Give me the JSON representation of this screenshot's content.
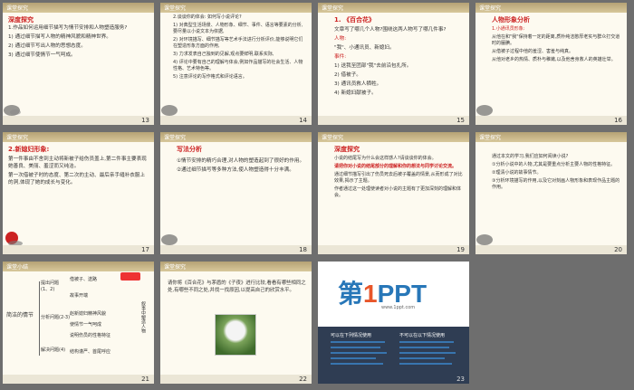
{
  "slides": [
    {
      "num": "13",
      "header": "课堂探究",
      "section": "深度探究",
      "question": "1.作品如何运用细节描写为情节安排和人物塑造服务?",
      "items": [
        "1) 通过细节描写人物的精神风貌和精神世界。",
        "2) 通过细节写出人物的思想态度。",
        "3) 通过细节使情节一气呵成。"
      ]
    },
    {
      "num": "14",
      "header": "课堂探究",
      "items": [
        "2.谈谈你的体会: 如何写小说评论?",
        "1) 对典型生活场景、人物形象、细节、事件、语言等要素的分析,要尽量以小说文本为依据,",
        "2) 对环境描写、细节描写等艺术手法进行分析评价,能够说明它们在塑造形象方面的作用,",
        "3) 力求发表自己独到的见解,观点要鲜明,联系实际,",
        "4) 评论中要有自己的理解与体会,例如作品描写的社会生活、人物性格、艺术特色等。",
        "5) 注意评论的写作格式和评论语言。"
      ]
    },
    {
      "num": "15",
      "header": "课堂探究",
      "section": "1. 《百合花》",
      "items": [
        "文章写了哪几个人物?围绕这两人物写了哪几件事?",
        "人物:",
        "\"我\"、小通讯员、新媳妇。",
        "事件:",
        "1) 送我至团部\"我\"去前沿包扎所。",
        "2) 借被子。",
        "3) 通讯员救人牺牲。",
        "4) 新媳妇献被子。"
      ]
    },
    {
      "num": "16",
      "header": "课堂探究",
      "section": "人物形象分析",
      "items": [
        "1.小通讯员形象:",
        "从他在和\"我\"保持着一定的距离,质朴纯洁憨厚老实与群众打交道时的腼腆。",
        "从借被子过程中他的羞涩、害羞与纯真。",
        "从他对老乡的热情、质朴与稚嫩,以及他舍身救人的英雄壮举。"
      ]
    },
    {
      "num": "17",
      "header": "课堂探究",
      "section": "2.新媳妇形象:",
      "items": [
        "第一件事由不舍到主动将新被子给伤员盖上,第二件事主要表现她善良、美丽、羞涩而又纯洁。",
        "第一次借被子时的态度、第二次的主动、最后亲手缝补衣服上的洞,体现了她的成长与变化。"
      ]
    },
    {
      "num": "18",
      "header": "课堂探究",
      "section": "写法分析",
      "items": [
        "①情节安排的精巧合理,对人物的塑造起到了很好的作用。",
        "②通过细节描写等多种方法,使人物塑造得十分丰满。"
      ]
    },
    {
      "num": "19",
      "header": "课堂探究",
      "section": "深度探究",
      "items": [
        "小说的结尾写为什么会这样感人?请谈谈你的体会。",
        "请把你对小说的结尾部分的理解和你的想法与同学讨论交流。",
        "通过细节描写引出了伤员死去后被子覆盖的情景,从而形成了对比效果,揭示了主题。",
        "作者通过这一处理使读者对小说的主题有了更加深刻的理解和体会。"
      ]
    },
    {
      "num": "20",
      "header": "课堂探究",
      "items": [
        "通过本文的学习,我们应如何阅读小说?",
        "①分析小说中的人物,尤其是要重点分析主要人物的性格特征。",
        "②理清小说的故事情节。",
        "③分析环境描写的作用,以及它对刻画人物形象和表现作品主题的作用。"
      ]
    },
    {
      "num": "21",
      "header": "课堂小结",
      "labels": {
        "plot": "简洁的情节",
        "a": "提出问题(1、2)",
        "b": "分析问题(2-3)",
        "c": "解决问题(4)",
        "d1": "借被子、送路",
        "d2": "故事开端",
        "e1": "赵新媳妇精神风貌",
        "e2": "使情节一气呵成",
        "f1": "说明伤员的性格特征",
        "g1": "结构谨严、首尾呼应",
        "side": "叙事中塑造人物"
      }
    },
    {
      "num": "22",
      "header": "课堂探究",
      "text": "请你将《百合花》与茅盾的《子夜》进行比较,看看有哪些相同之处,有哪些不同之处,并找一找原因,以提高自己的欣赏水平。"
    },
    {
      "num": "23",
      "logo_main": "第",
      "logo_num": "1",
      "logo_tail": "PPT",
      "logo_url": "www.1ppt.com",
      "col1": "可以在下列情况使用",
      "col2": "不可以在以下情况使用"
    }
  ]
}
